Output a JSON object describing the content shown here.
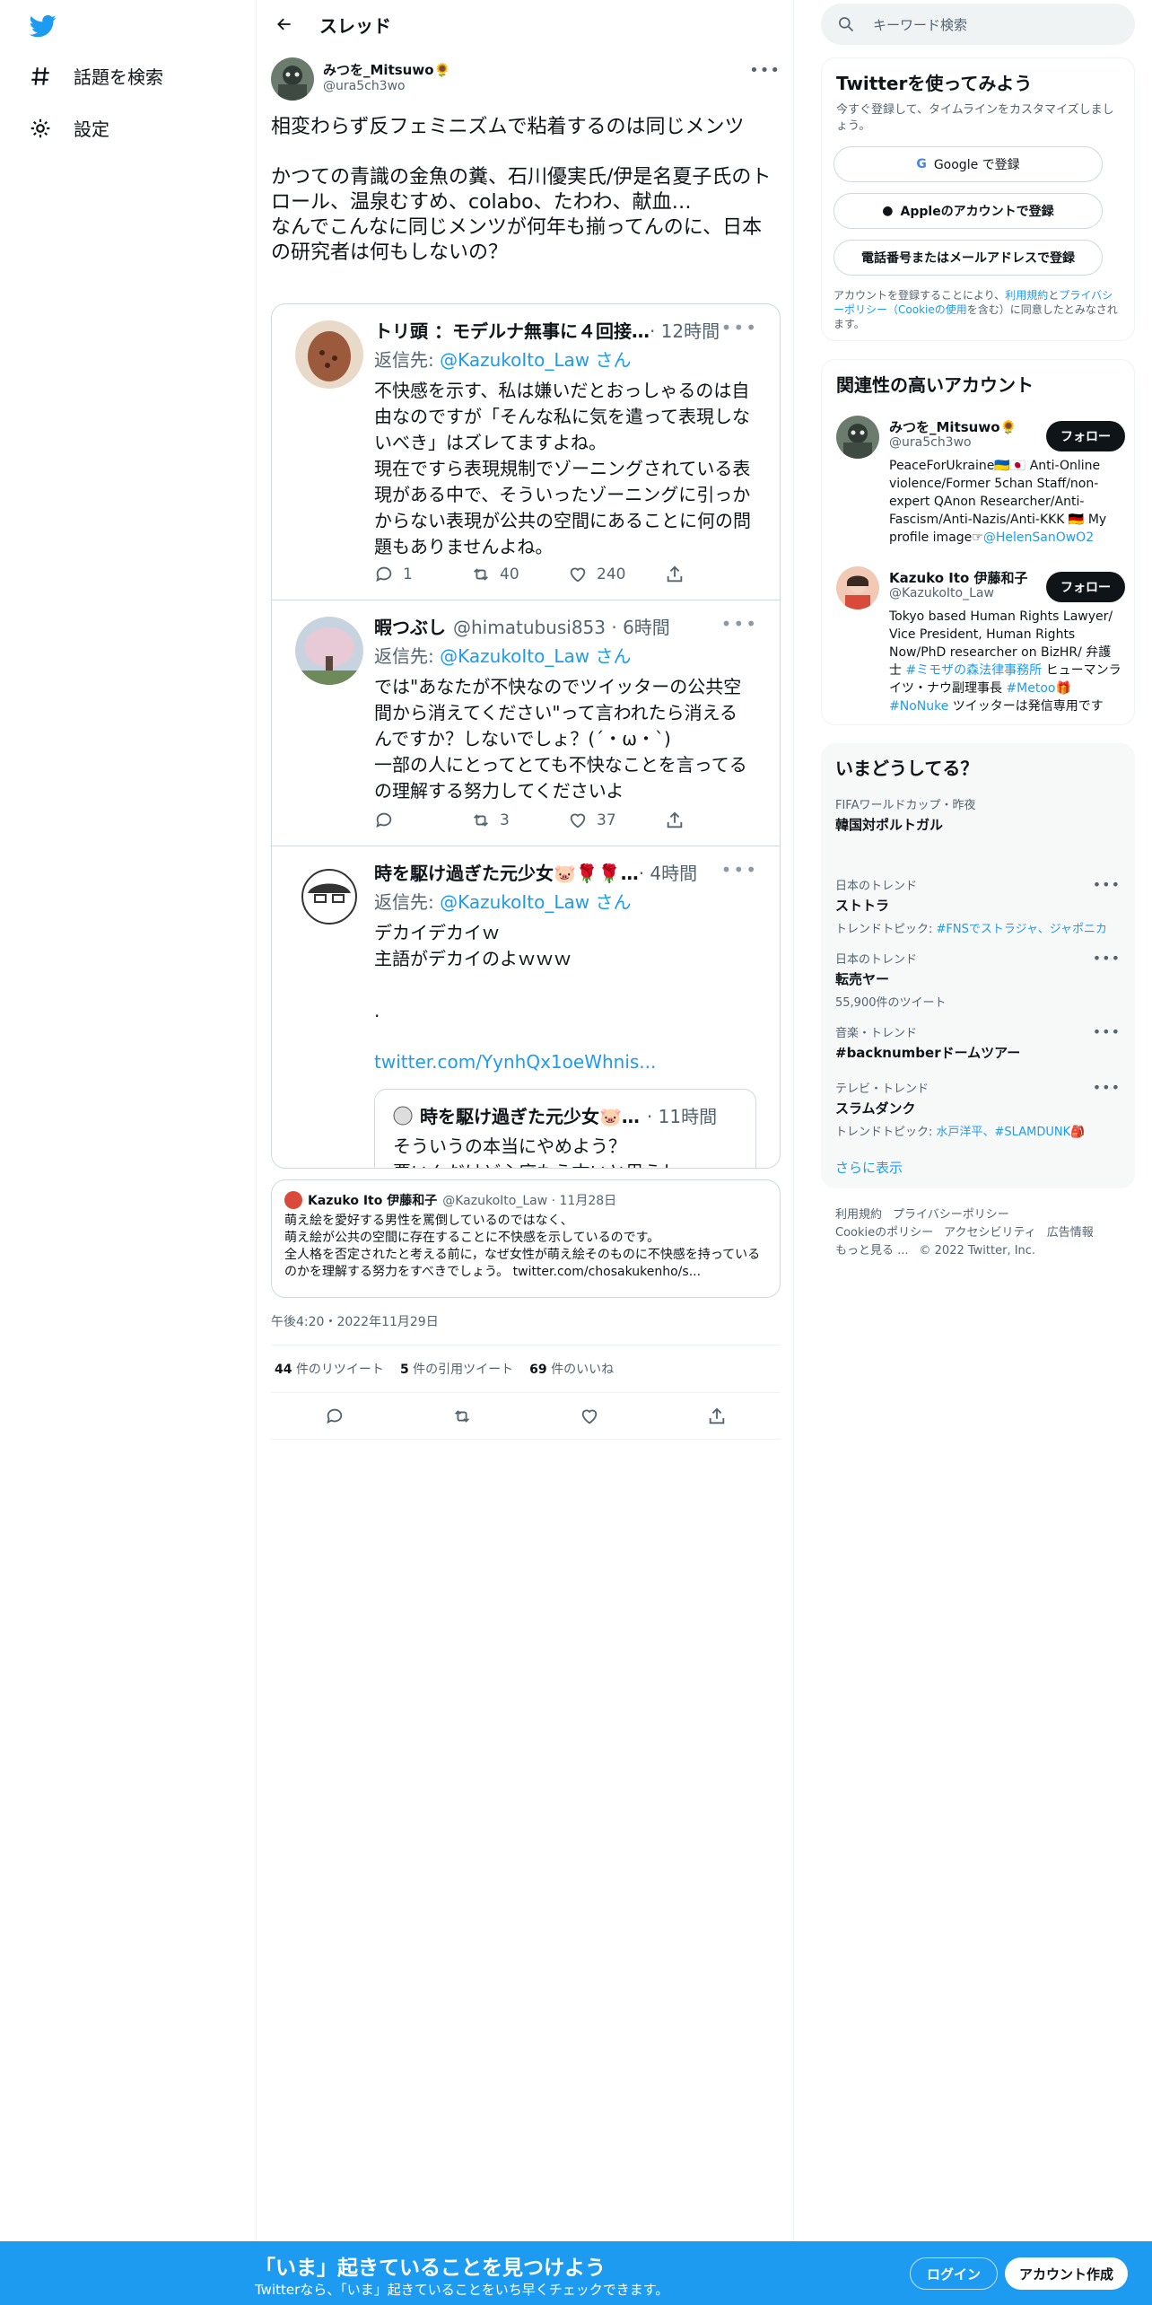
{
  "nav": {
    "explore_label": "話題を検索",
    "settings_label": "設定"
  },
  "header": {
    "title": "スレッド"
  },
  "tweet": {
    "author_name": "みつを_Mitsuwo🌻",
    "author_handle": "@ura5ch3wo",
    "text": "相変わらず反フェミニズムで粘着するのは同じメンツ\n\nかつての青識の金魚の糞、石川優実氏/伊是名夏子氏のトロール、温泉むすめ、colabo、たわわ、献血…\nなんでこんなに同じメンツが何年も揃ってんのに、日本の研究者は何もしないの？",
    "timestamp": "午後4:20・2022年11月29日",
    "retweets": "44",
    "retweets_label": "件のリツイート",
    "quotes": "5",
    "quotes_label": "件の引用ツイート",
    "likes": "69",
    "likes_label": "件のいいね"
  },
  "replies": [
    {
      "name": "トリ頭 ：モデルナ無事に４回接…",
      "meta": "· 12時間",
      "replyto_prefix": "返信先:",
      "replyto_handle": "@KazukoIto_Law",
      "replyto_suffix": "さん",
      "text": "不快感を示す、私は嫌いだとおっしゃるのは自由なのですが「そんな私に気を遣って表現しないべき」はズレてますよね。\n現在ですら表現規制でゾーニングされている表現がある中で、そういったゾーニングに引っかからない表現が公共の空間にあることに何の問題もありませんよね。",
      "reply_count": "1",
      "retweet_count": "40",
      "like_count": "240"
    },
    {
      "name": "暇つぶし",
      "meta": "@himatubusi853 · 6時間",
      "replyto_prefix": "返信先:",
      "replyto_handle": "@KazukoIto_Law",
      "replyto_suffix": "さん",
      "text": "では\"あなたが不快なのでツイッターの公共空間から消えてください\"って言われたら消えるんですか？しないでしょ？(´・ω・`)\n一部の人にとってとても不快なことを言ってるの理解する努力してくださいよ",
      "reply_count": "",
      "retweet_count": "3",
      "like_count": "37"
    },
    {
      "name": "時を駆け過ぎた元少女🐷🌹🌹…",
      "meta": "· 4時間",
      "replyto_prefix": "返信先:",
      "replyto_handle": "@KazukoIto_Law",
      "replyto_suffix": "さん",
      "text": "デカイデカイｗ\n主語がデカイのよｗｗｗ\n\n.",
      "link": "twitter.com/YynhQx1oeWhnis...",
      "quote_name": "時を駆け過ぎた元少女🐷…",
      "quote_meta": "· 11時間",
      "quote_text": "そういうの本当にやめよう？\n悪いんだけど心底もう古いと思うし\nむしろ差別的な思想だと思うのよ"
    }
  ],
  "quoted": {
    "name": "Kazuko Ito 伊藤和子",
    "meta": "@KazukoIto_Law · 11月28日",
    "text": "萌え絵を愛好する男性を罵倒しているのではなく、\n萌え絵が公共の空間に存在することに不快感を示しているのです。\n全人格を否定されたと考える前に，なぜ女性が萌え絵そのものに不快感を持っているのかを理解する努力をすべきでしょう。 twitter.com/chosakukenho/s..."
  },
  "search": {
    "placeholder": "キーワード検索"
  },
  "signup": {
    "title": "Twitterを使ってみよう",
    "subtitle": "今すぐ登録して、タイムラインをカスタマイズしましょう。",
    "google": "Google で登録",
    "apple": "Appleのアカウントで登録",
    "phone": "電話番号またはメールアドレスで登録",
    "legal_prefix": "アカウントを登録することにより、",
    "legal_terms": "利用規約",
    "legal_and": "と",
    "legal_privacy": "プライバシーポリシー（Cookieの使用",
    "legal_suffix": "を含む）に同意したとみなされます。"
  },
  "related": {
    "title": "関連性の高いアカウント",
    "follow_label": "フォロー",
    "accounts": [
      {
        "name": "みつを_Mitsuwo🌻",
        "handle": "@ura5ch3wo",
        "bio": "PeaceForUkraine🇺🇦🇯🇵 Anti-Online violence/Former 5chan Staff/non-expert QAnon Researcher/Anti-Fascism/Anti-Nazis/Anti-KKK 🇩🇪 My profile image☞",
        "bio_link": "@HelenSanOwO2"
      },
      {
        "name": "Kazuko Ito 伊藤和子",
        "handle": "@KazukoIto_Law",
        "bio": "Tokyo based Human Rights Lawyer/ Vice President, Human Rights Now/PhD researcher on BizHR/ 弁護士",
        "bio_link": "#ミモザの森法律事務所",
        "bio_tail": " ヒューマンライツ・ナウ副理事長 ",
        "bio_link2": "#Metoo",
        "bio_tail2": "🎁 ",
        "bio_link3": "#NoNuke",
        "bio_tail3": " ツイッターは発信専用です"
      }
    ]
  },
  "trends": {
    "title": "いまどうしてる？",
    "items": [
      {
        "meta": "FIFAワールドカップ・昨夜",
        "name": "韓国対ポルトガル",
        "topic": ""
      },
      {
        "meta": "日本のトレンド",
        "name": "ストトラ",
        "topic_prefix": "トレンドトピック:",
        "topic": "#FNSでストラジャ、ジャポニカ"
      },
      {
        "meta": "日本のトレンド",
        "name": "転売ヤー",
        "count": "55,900件のツイート"
      },
      {
        "meta": "音楽・トレンド",
        "name": "#backnumberドームツアー",
        "topic": ""
      },
      {
        "meta": "テレビ・トレンド",
        "name": "スラムダンク",
        "topic_prefix": "トレンドトピック:",
        "topic": "水戸洋平、#SLAMDUNK🎒"
      }
    ],
    "show_more": "さらに表示"
  },
  "footer": {
    "terms": "利用規約",
    "privacy": "プライバシーポリシー",
    "cookie": "Cookieのポリシー",
    "accessibility": "アクセシビリティ",
    "ads": "広告情報",
    "more": "もっと見る ...",
    "copyright": "© 2022 Twitter, Inc."
  },
  "bottom_bar": {
    "title": "「いま」起きていることを見つけよう",
    "subtitle": "Twitterなら、「いま」起きていることをいち早くチェックできます。",
    "login": "ログイン",
    "signup": "アカウント作成"
  },
  "colors": {
    "accent": "#1d9bf0",
    "text": "#0f1419",
    "muted": "#536471"
  }
}
